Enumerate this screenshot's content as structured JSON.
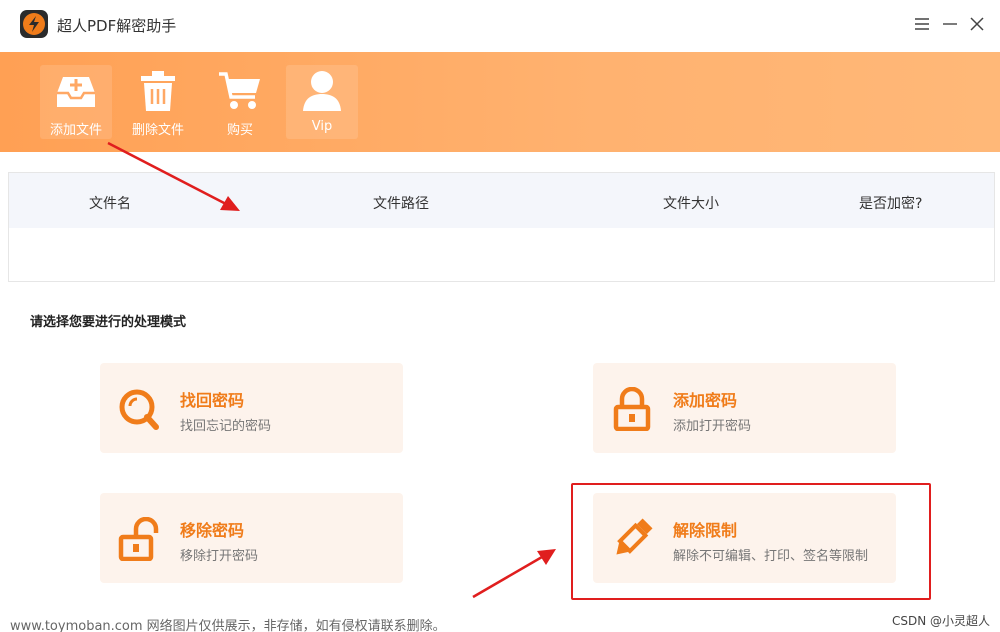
{
  "app": {
    "title": "超人PDF解密助手",
    "window_controls": [
      "menu-icon",
      "minimize-icon",
      "close-icon"
    ]
  },
  "toolbar": {
    "items": [
      {
        "label": "添加文件",
        "icon": "add-file-icon"
      },
      {
        "label": "删除文件",
        "icon": "trash-icon"
      },
      {
        "label": "购买",
        "icon": "cart-icon"
      },
      {
        "label": "Vip",
        "icon": "user-icon"
      }
    ]
  },
  "table": {
    "columns": [
      "文件名",
      "文件路径",
      "文件大小",
      "是否加密?"
    ],
    "rows": []
  },
  "mode_section": {
    "title": "请选择您要进行的处理模式",
    "cards": [
      {
        "title": "找回密码",
        "desc": "找回忘记的密码",
        "icon": "magnifier-icon"
      },
      {
        "title": "添加密码",
        "desc": "添加打开密码",
        "icon": "lock-icon"
      },
      {
        "title": "移除密码",
        "desc": "移除打开密码",
        "icon": "unlock-icon"
      },
      {
        "title": "解除限制",
        "desc": "解除不可编辑、打印、签名等限制",
        "icon": "pencil-icon"
      }
    ]
  },
  "watermarks": {
    "left": "www.toymoban.com 网络图片仅供展示，非存储，如有侵权请联系删除。",
    "right": "CSDN @小灵超人"
  },
  "colors": {
    "accent": "#f07c1a",
    "toolbar_start": "#ffa054",
    "toolbar_end": "#ffb878",
    "card_bg": "#fdf3ec",
    "annotation_red": "#e01e1e"
  }
}
